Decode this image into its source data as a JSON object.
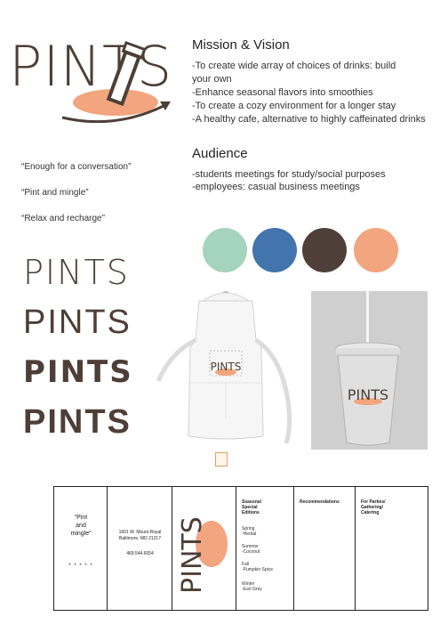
{
  "logo": {
    "text": "PINTS"
  },
  "mission": {
    "title": "Mission & Vision",
    "lines": [
      "-To create wide array of choices of drinks: build\nyour own",
      "-Enhance seasonal flavors into smoothies",
      "-To create a cozy environment for a longer stay",
      "-A healthy cafe, alternative to highly caffeinated drinks"
    ]
  },
  "audience": {
    "title": "Audience",
    "lines": [
      "-students meetings for study/social purposes",
      "-employees: casual business meetings"
    ]
  },
  "taglines": [
    "“Enough for a conversation”",
    "“Pint and mingle”",
    "“Relax and recharge”"
  ],
  "palette": [
    "#a4d4bd",
    "#4274ad",
    "#4e4039",
    "#f2a57e"
  ],
  "type_samples": [
    "PINTS",
    "PINTS",
    "PINTS",
    "PINTS"
  ],
  "apron": {
    "logo_text": "PINTS"
  },
  "cup": {
    "logo_text": "PINTS"
  },
  "brochure": {
    "quote": "“Pint\nand\nmingle”",
    "stars": "* * * * *",
    "address": "1601 W. Mount Royal\nBaltimore, MD 21217",
    "phone": "469.544.6054",
    "spine_logo": "PINTS",
    "seasonal_title": "Seasonal\nSpecial\nEditions",
    "seasons": [
      "Spring\n-Herbal",
      "Summer\n-Coconut",
      "Fall\n-Pumpkin Spice",
      "Winter\n-Earl Grey"
    ],
    "recommendations_title": "Recommendations",
    "parties_title": "For Parties/\nGathering/\nCatering"
  },
  "colors": {
    "brand_brown": "#4d3f37",
    "brand_peach": "#f2a57e"
  }
}
